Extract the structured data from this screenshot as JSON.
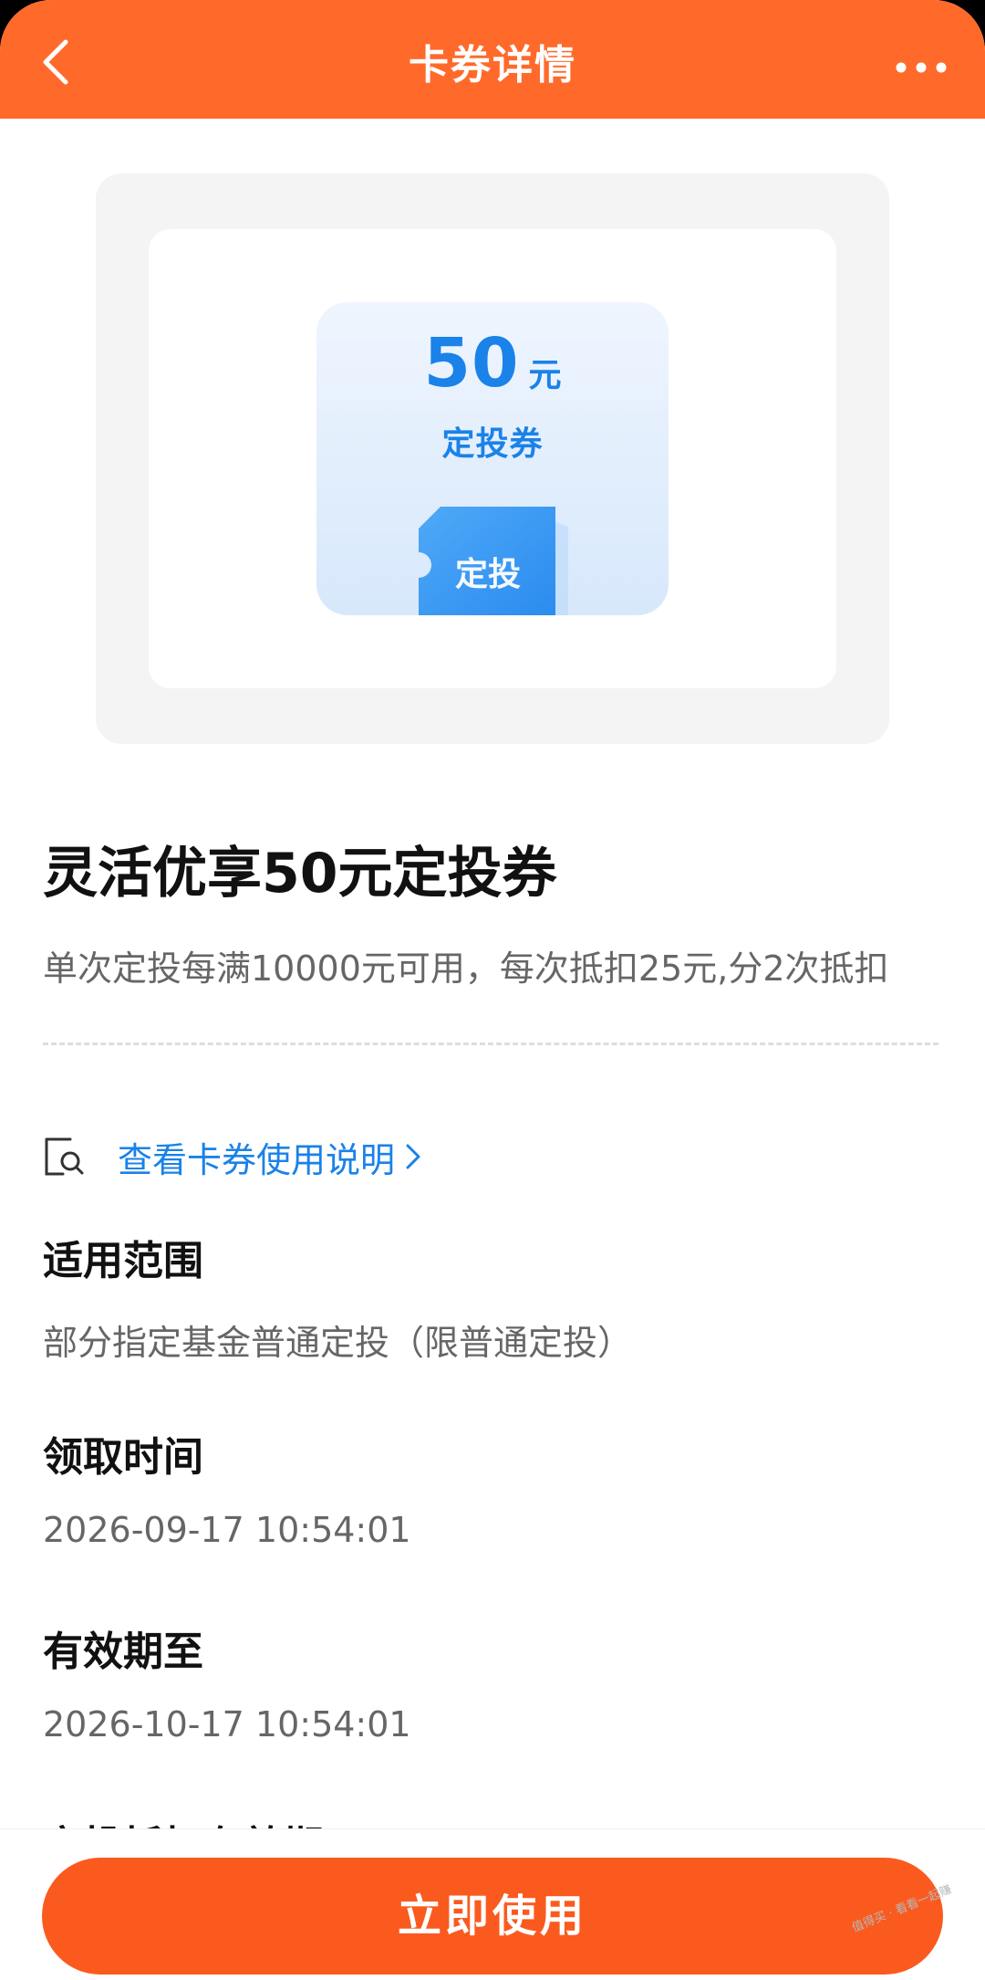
{
  "header": {
    "title": "卡券详情"
  },
  "coupon_preview": {
    "amount": "50",
    "unit": "元",
    "type_label": "定投券",
    "ticket_label": "定投"
  },
  "coupon": {
    "title": "灵活优享50元定投券",
    "description": "单次定投每满10000元可用，每次抵扣25元,分2次抵扣"
  },
  "guide_link": {
    "label": "查看卡券使用说明"
  },
  "details": [
    {
      "heading": "适用范围",
      "value": "部分指定基金普通定投（限普通定投）"
    },
    {
      "heading": "领取时间",
      "value": "2026-09-17 10:54:01"
    },
    {
      "heading": "有效期至",
      "value": "2026-10-17 10:54:01"
    }
  ],
  "partially_visible_heading": "定投抵扣有效期",
  "bottom": {
    "use_button_label": "立即使用"
  },
  "watermark": "值得买 · 看看一起赚",
  "colors": {
    "accent_orange": "#ff6a2b",
    "button_orange": "#fb5a1f",
    "link_blue": "#1a82e8"
  }
}
